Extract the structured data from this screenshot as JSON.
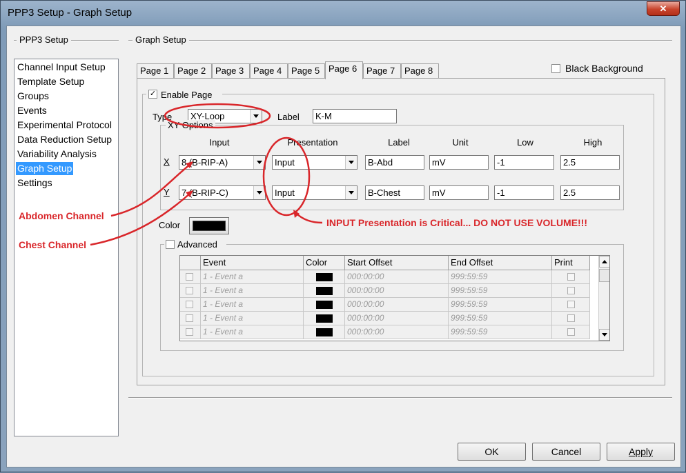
{
  "window": {
    "title": "PPP3 Setup - Graph Setup",
    "close_label": "✕"
  },
  "left_group": {
    "label": "PPP3 Setup",
    "items": [
      "Channel Input Setup",
      "Template Setup",
      "Groups",
      "Events",
      "Experimental Protocol",
      "Data Reduction Setup",
      "Variability Analysis",
      "Graph Setup",
      "Settings"
    ],
    "selected": "Graph Setup"
  },
  "graph_group": {
    "label": "Graph Setup"
  },
  "tabs": [
    "Page 1",
    "Page 2",
    "Page 3",
    "Page 4",
    "Page 5",
    "Page 6",
    "Page 7",
    "Page 8"
  ],
  "active_tab": "Page 6",
  "black_background": {
    "label": "Black Background",
    "checked": false
  },
  "enable_page": {
    "label": "Enable Page",
    "checked": true,
    "mark": "✓"
  },
  "type": {
    "label": "Type",
    "value": "XY-Loop"
  },
  "label_field": {
    "label": "Label",
    "value": "K-M"
  },
  "xy_options": {
    "label": "XY Options",
    "headers": {
      "input": "Input",
      "presentation": "Presentation",
      "label": "Label",
      "unit": "Unit",
      "low": "Low",
      "high": "High"
    },
    "rows": [
      {
        "axis": "X",
        "input": "8 (B-RIP-A)",
        "presentation": "Input",
        "label": "B-Abd",
        "unit": "mV",
        "low": "-1",
        "high": "2.5"
      },
      {
        "axis": "Y",
        "input": "7 (B-RIP-C)",
        "presentation": "Input",
        "label": "B-Chest",
        "unit": "mV",
        "low": "-1",
        "high": "2.5"
      }
    ]
  },
  "color": {
    "label": "Color",
    "value": "#000000"
  },
  "advanced": {
    "label": "Advanced",
    "checked": false,
    "columns": [
      "Event",
      "Color",
      "Start Offset",
      "End Offset",
      "Print"
    ],
    "rows": [
      {
        "event": "1 - Event a",
        "start": "000:00:00",
        "end": "999:59:59"
      },
      {
        "event": "1 - Event a",
        "start": "000:00:00",
        "end": "999:59:59"
      },
      {
        "event": "1 - Event a",
        "start": "000:00:00",
        "end": "999:59:59"
      },
      {
        "event": "1 - Event a",
        "start": "000:00:00",
        "end": "999:59:59"
      },
      {
        "event": "1 - Event a",
        "start": "000:00:00",
        "end": "999:59:59"
      }
    ]
  },
  "buttons": {
    "ok": "OK",
    "cancel": "Cancel",
    "apply": "Apply"
  },
  "annotations": {
    "abdomen": "Abdomen Channel",
    "chest": "Chest Channel",
    "presentation_note": "INPUT Presentation is Critical... DO NOT USE VOLUME!!!",
    "color": "#d9262a"
  }
}
